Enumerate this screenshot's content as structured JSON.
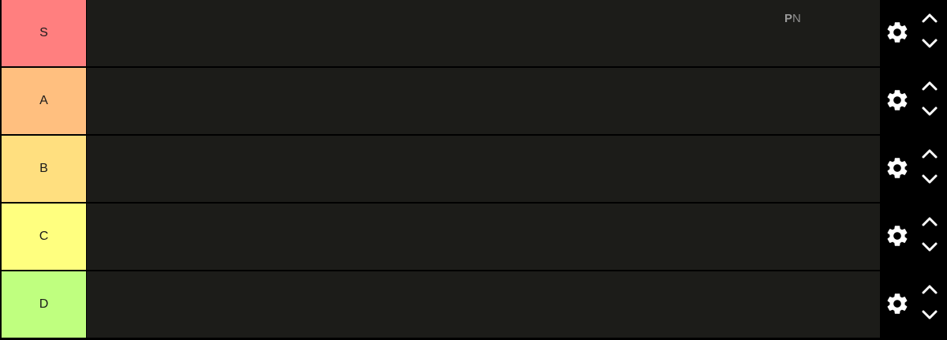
{
  "tiers": [
    {
      "label": "S",
      "color": "#ff7f7f"
    },
    {
      "label": "A",
      "color": "#ffbf7f"
    },
    {
      "label": "B",
      "color": "#ffdf7f"
    },
    {
      "label": "C",
      "color": "#ffff7f"
    },
    {
      "label": "D",
      "color": "#bfff7f"
    }
  ],
  "watermark": {
    "bold": "P",
    "rest": "N"
  },
  "icons": {
    "settings": "gear-icon",
    "up": "chevron-up-icon",
    "down": "chevron-down-icon"
  }
}
